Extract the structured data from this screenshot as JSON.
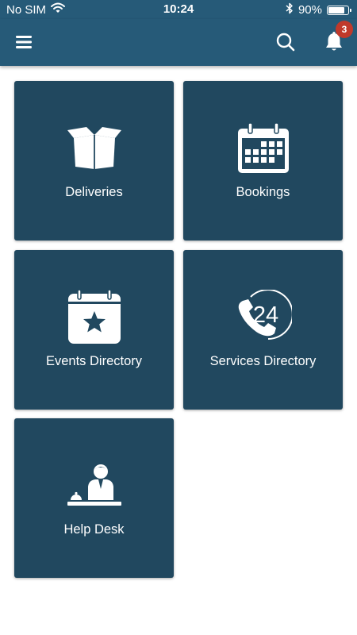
{
  "status_bar": {
    "carrier": "No SIM",
    "time": "10:24",
    "battery": "90%",
    "battery_level": 0.9
  },
  "header": {
    "menu_icon": "hamburger-menu-icon",
    "search_icon": "search-icon",
    "notifications_icon": "bell-icon",
    "notification_count": "3"
  },
  "tiles": [
    {
      "label": "Deliveries",
      "icon": "package-box-icon"
    },
    {
      "label": "Bookings",
      "icon": "calendar-grid-icon"
    },
    {
      "label": "Events Directory",
      "icon": "calendar-star-icon"
    },
    {
      "label": "Services Directory",
      "icon": "phone-24-icon"
    },
    {
      "label": "Help Desk",
      "icon": "receptionist-icon"
    }
  ],
  "colors": {
    "header": "#265a78",
    "tile": "#21485f",
    "badge": "#c0392b"
  }
}
